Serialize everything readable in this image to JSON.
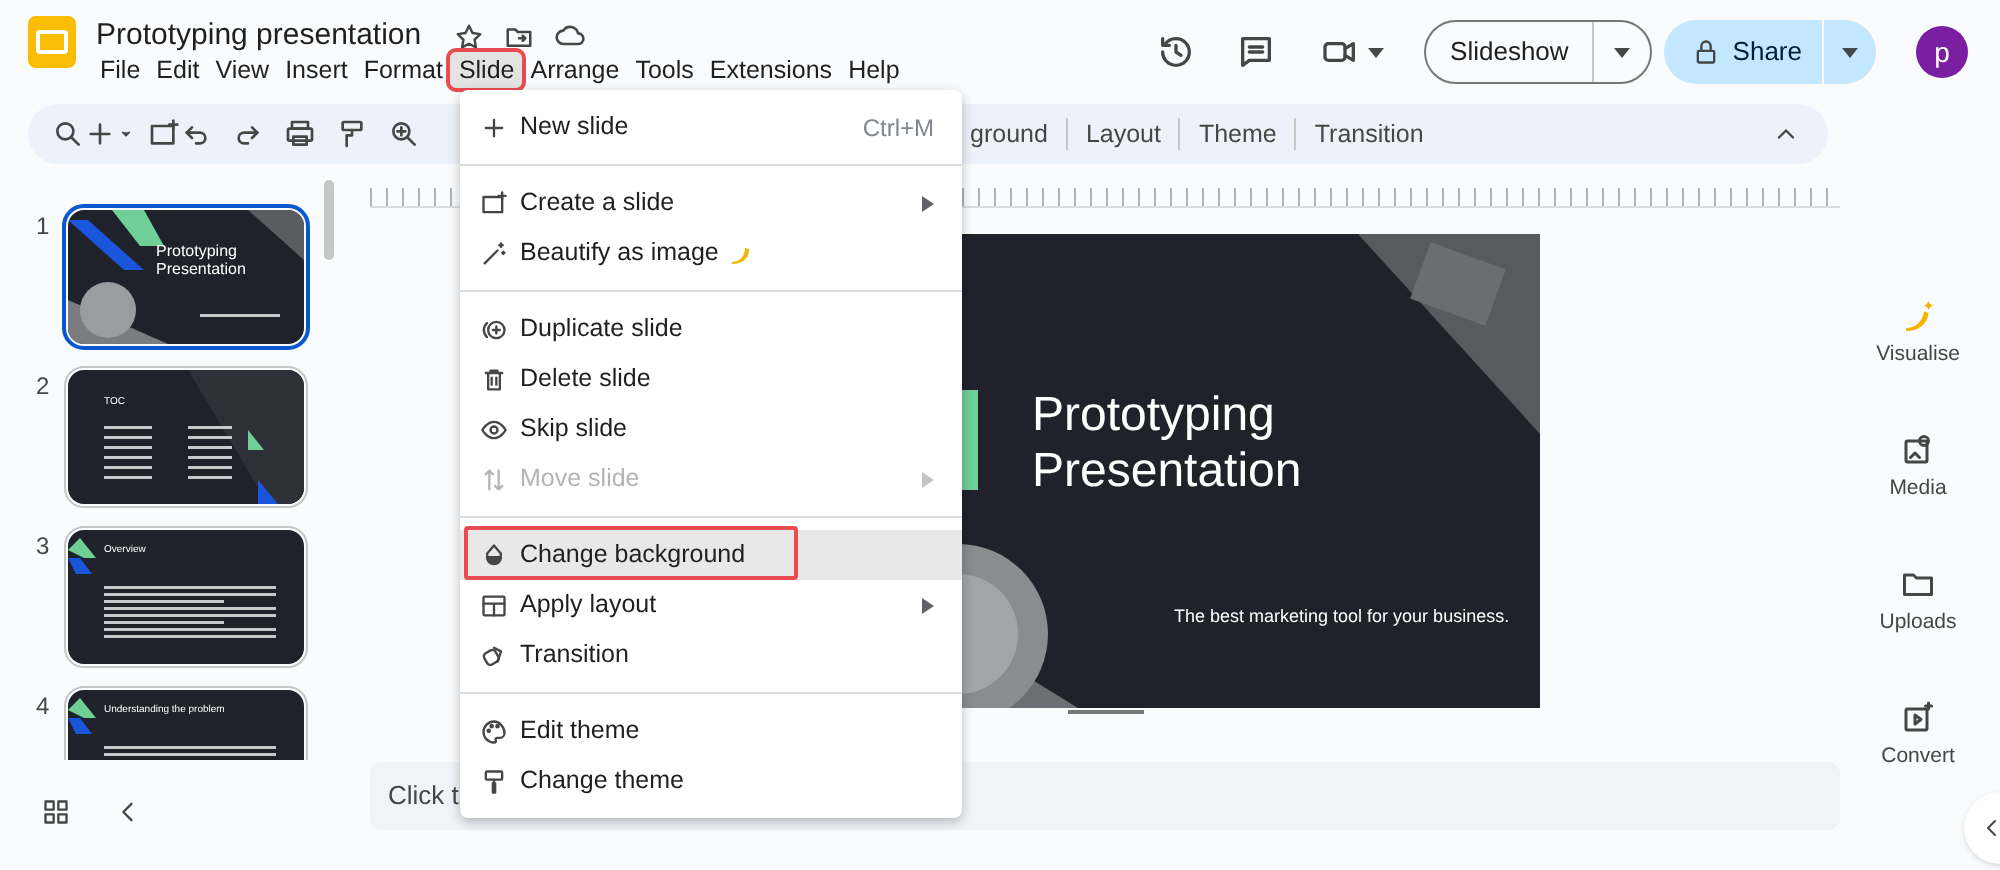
{
  "document": {
    "title": "Prototyping presentation"
  },
  "menu_bar": [
    {
      "label": "File",
      "selected": false
    },
    {
      "label": "Edit",
      "selected": false
    },
    {
      "label": "View",
      "selected": false
    },
    {
      "label": "Insert",
      "selected": false
    },
    {
      "label": "Format",
      "selected": false
    },
    {
      "label": "Slide",
      "selected": true
    },
    {
      "label": "Arrange",
      "selected": false
    },
    {
      "label": "Tools",
      "selected": false
    },
    {
      "label": "Extensions",
      "selected": false
    },
    {
      "label": "Help",
      "selected": false
    }
  ],
  "header": {
    "slideshow_button": "Slideshow",
    "share_button": "Share",
    "avatar": "p"
  },
  "toolbar": {
    "tabs": [
      "ground",
      "Layout",
      "Theme",
      "Transition"
    ]
  },
  "slide_menu": [
    {
      "kind": "item",
      "label": "New slide",
      "shortcut": "Ctrl+M",
      "submenu": false,
      "disabled": false,
      "selected": false
    },
    {
      "kind": "separator"
    },
    {
      "kind": "item",
      "label": "Create a slide",
      "submenu": true,
      "disabled": false,
      "selected": false
    },
    {
      "kind": "item",
      "label": "Beautify as image",
      "submenu": false,
      "disabled": false,
      "selected": false
    },
    {
      "kind": "separator"
    },
    {
      "kind": "item",
      "label": "Duplicate slide",
      "submenu": false,
      "disabled": false,
      "selected": false
    },
    {
      "kind": "item",
      "label": "Delete slide",
      "submenu": false,
      "disabled": false,
      "selected": false
    },
    {
      "kind": "item",
      "label": "Skip slide",
      "submenu": false,
      "disabled": false,
      "selected": false
    },
    {
      "kind": "item",
      "label": "Move slide",
      "submenu": true,
      "disabled": true,
      "selected": false
    },
    {
      "kind": "separator"
    },
    {
      "kind": "item",
      "label": "Change background",
      "submenu": false,
      "disabled": false,
      "selected": true
    },
    {
      "kind": "item",
      "label": "Apply layout",
      "submenu": true,
      "disabled": false,
      "selected": false
    },
    {
      "kind": "item",
      "label": "Transition",
      "submenu": false,
      "disabled": false,
      "selected": false
    },
    {
      "kind": "separator"
    },
    {
      "kind": "item",
      "label": "Edit theme",
      "submenu": false,
      "disabled": false,
      "selected": false
    },
    {
      "kind": "item",
      "label": "Change theme",
      "submenu": false,
      "disabled": false,
      "selected": false
    }
  ],
  "slides": [
    {
      "number": "1",
      "title": "Prototyping Presentation",
      "selected": true
    },
    {
      "number": "2",
      "title": "TOC",
      "selected": false
    },
    {
      "number": "3",
      "title": "Overview",
      "selected": false
    },
    {
      "number": "4",
      "title": "Understanding the problem",
      "selected": false
    }
  ],
  "current_slide": {
    "title": "Prototyping Presentation",
    "subtitle": "The best marketing tool for your business."
  },
  "side_panel": [
    {
      "label": "Visualise"
    },
    {
      "label": "Media"
    },
    {
      "label": "Uploads"
    },
    {
      "label": "Convert"
    }
  ],
  "speaker_notes": {
    "placeholder": "Click t"
  }
}
